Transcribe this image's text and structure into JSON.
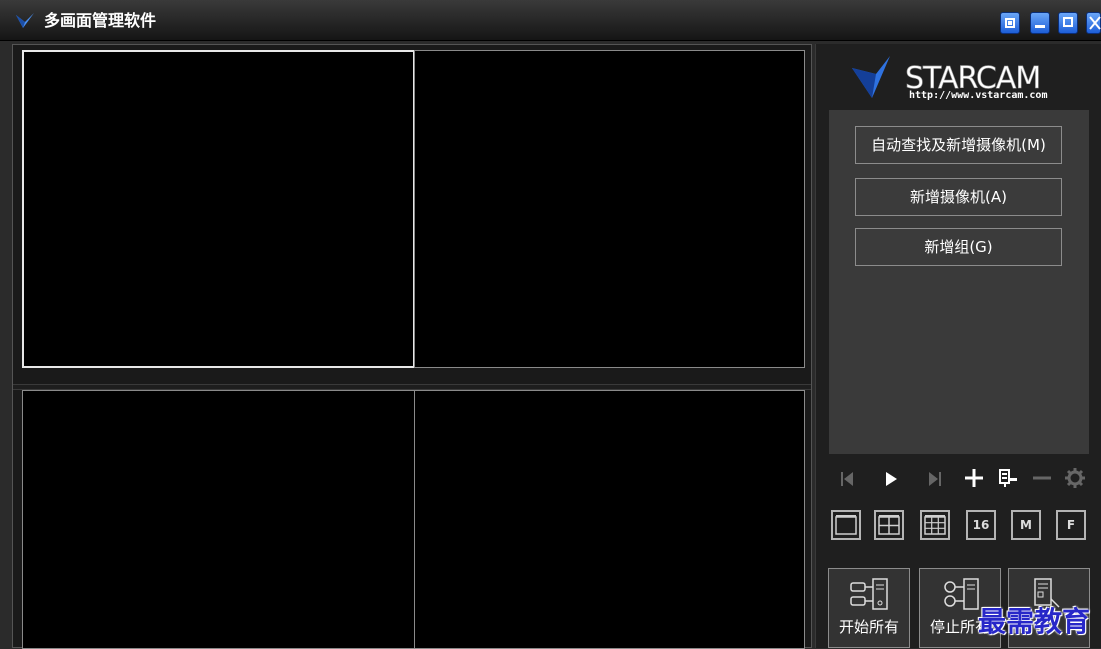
{
  "window": {
    "title": "多画面管理软件",
    "controls": [
      "pip-icon",
      "minimize-icon",
      "maximize-icon",
      "close-icon"
    ]
  },
  "brand": {
    "name": "STARCAM",
    "url": "http://www.vstarcam.com",
    "accent": "#1e63d6"
  },
  "actions": {
    "auto_find": "自动查找及新增摄像机(M)",
    "add_camera": "新增摄像机(A)",
    "add_group": "新增组(G)"
  },
  "controls": [
    "previous-icon",
    "play-icon",
    "next-icon",
    "add-icon",
    "record-icon",
    "minus-icon",
    "settings-icon"
  ],
  "layouts": [
    {
      "icon": "single-view-icon",
      "label": ""
    },
    {
      "icon": "four-view-icon",
      "label": ""
    },
    {
      "icon": "nine-view-icon",
      "label": ""
    },
    {
      "icon": "sixteen-view-icon",
      "label": "16"
    },
    {
      "icon": "mode-m-icon",
      "label": "M"
    },
    {
      "icon": "fullscreen-icon",
      "label": "F"
    }
  ],
  "big_buttons": {
    "start_all": "开始所有",
    "stop_all": "停止所有",
    "third": ""
  },
  "watermark": "最需教育"
}
